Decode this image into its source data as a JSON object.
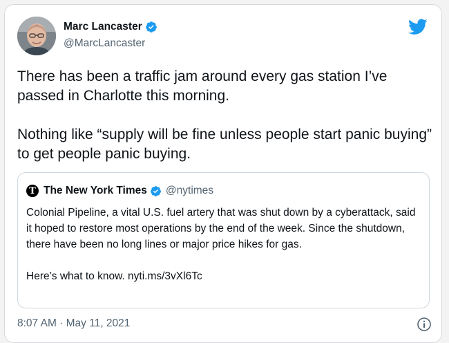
{
  "author": {
    "name": "Marc Lancaster",
    "handle": "@MarcLancaster",
    "avatar_icon": "avatar-photo",
    "verified_icon": "verified-badge-icon"
  },
  "tweet": {
    "text": "There has been a traffic jam around every gas station I’ve passed in Charlotte this morning.\n\nNothing like “supply will be fine unless people start panic buying” to get people panic buying.",
    "timestamp": "8:07 AM · May 11, 2021"
  },
  "quoted_tweet": {
    "name": "The New York Times",
    "handle": "@nytimes",
    "logo_letter": "T",
    "text": "Colonial Pipeline, a vital U.S. fuel artery that was shut down by a cyberattack, said it hoped to restore most operations by the end of the week. Since the shutdown, there have been no long lines or major price hikes for gas.\n\nHere’s what to know. nyti.ms/3vXl6Tc"
  },
  "icons": {
    "brand": "twitter-bird-icon",
    "info": "info-icon"
  },
  "colors": {
    "brand_blue": "#1d9bf0",
    "text_primary": "#0f1419",
    "text_secondary": "#536471",
    "border": "#cfd9de"
  }
}
